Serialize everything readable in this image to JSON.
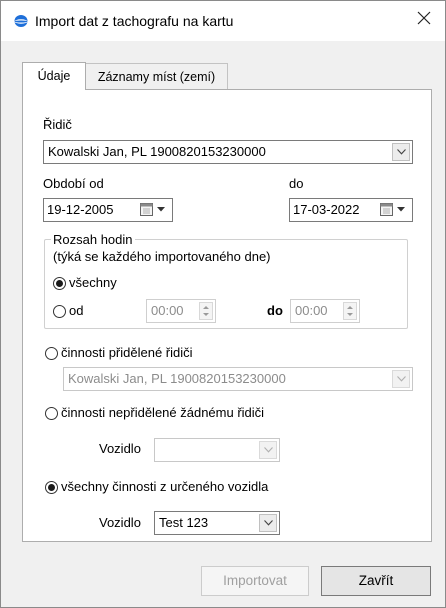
{
  "window": {
    "title": "Import dat z tachografu na kartu",
    "close_icon": "close-icon",
    "app_icon": "app-icon"
  },
  "tabs": [
    {
      "label": "Údaje",
      "active": true
    },
    {
      "label": "Záznamy míst (zemí)",
      "active": false
    }
  ],
  "driver": {
    "label": "Řidič",
    "value": "Kowalski Jan, PL 1900820153230000"
  },
  "period": {
    "from_label": "Období od",
    "from_value": "19-12-2005",
    "to_label": "do",
    "to_value": "17-03-2022"
  },
  "hours": {
    "title_line1": "Rozsah hodin",
    "title_line2": "(týká se každého importovaného dne)",
    "all_label": "všechny",
    "all_checked": true,
    "from_label": "od",
    "from_checked": false,
    "from_value": "00:00",
    "to_label": "do",
    "to_value": "00:00"
  },
  "activities": {
    "assigned_label": "činnosti přidělené řidiči",
    "assigned_checked": false,
    "assigned_driver": "Kowalski Jan, PL 1900820153230000",
    "unassigned_label": "činnosti nepřidělené žádnému řidiči",
    "unassigned_checked": false,
    "unassigned_vehicle_label": "Vozidlo",
    "unassigned_vehicle_value": "",
    "vehicle_all_label": "všechny činnosti z určeného vozidla",
    "vehicle_all_checked": true,
    "vehicle_label": "Vozidlo",
    "vehicle_value": "Test 123"
  },
  "buttons": {
    "import_label": "Importovat",
    "close_label": "Zavřít"
  },
  "colors": {
    "app_icon_blue": "#1e6fd9",
    "dialog_bg": "#f0f0f0",
    "panel_bg": "#ffffff"
  }
}
